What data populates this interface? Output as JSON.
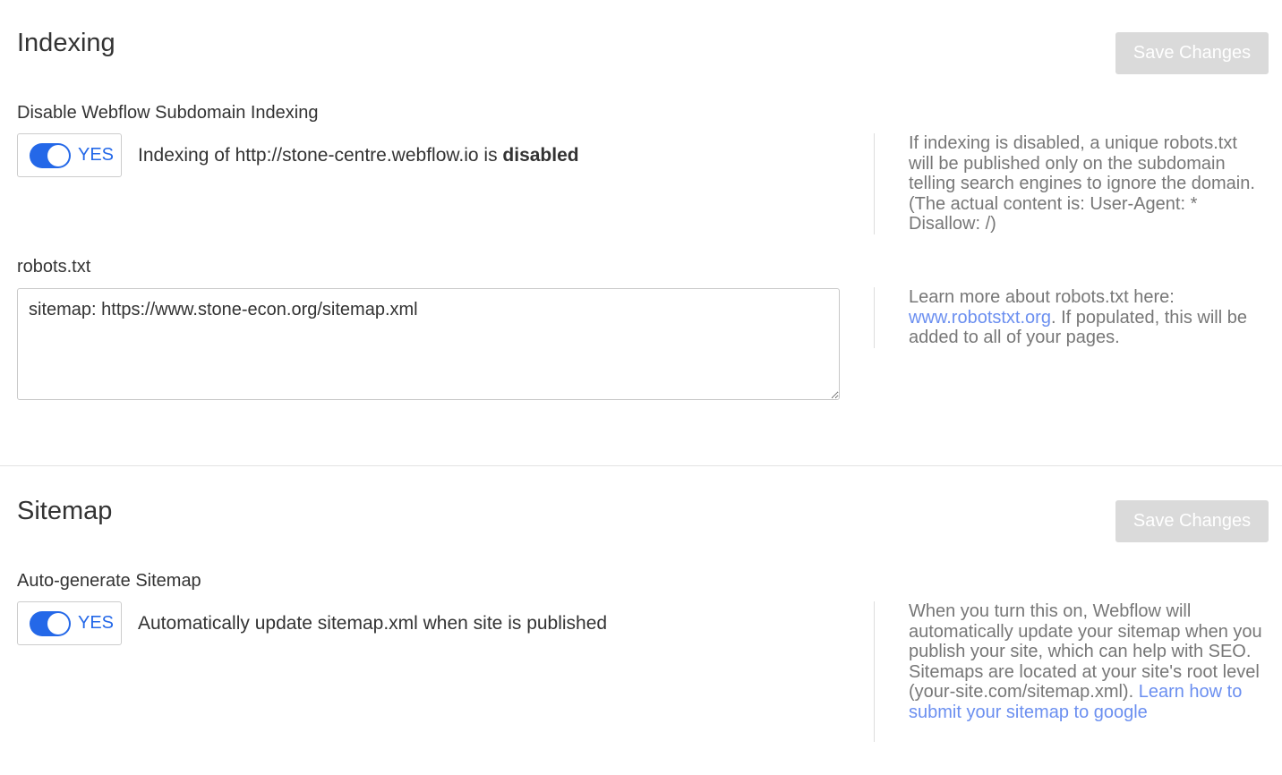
{
  "indexing": {
    "title": "Indexing",
    "save_label": "Save Changes",
    "subdomain_label": "Disable Webflow Subdomain Indexing",
    "toggle_label": "YES",
    "status_prefix": "Indexing of http://stone-centre.webflow.io is ",
    "status_bold": "disabled",
    "help_text": "If indexing is disabled, a unique robots.txt will be published only on the subdomain telling search engines to ignore the domain. (The actual content is: User-Agent: * Disallow: /)",
    "robots_label": "robots.txt",
    "robots_value": "sitemap: https://www.stone-econ.org/sitemap.xml",
    "robots_help_prefix": "Learn more about robots.txt here: ",
    "robots_help_link": "www.robotstxt.org",
    "robots_help_suffix": ". If populated, this will be added to all of your pages."
  },
  "sitemap": {
    "title": "Sitemap",
    "save_label": "Save Changes",
    "auto_label": "Auto-generate Sitemap",
    "toggle_label": "YES",
    "status_text": "Automatically update sitemap.xml when site is published",
    "help_text": "When you turn this on, Webflow will automatically update your sitemap when you publish your site, which can help with SEO. Sitemaps are located at your site's root level (your-site.com/sitemap.xml).",
    "help_link": "Learn how to submit your sitemap to google"
  },
  "colors": {
    "accent": "#2468e8",
    "link": "#6b8ff0",
    "button_disabled_bg": "#dadada",
    "help_text": "#777777"
  },
  "icons": {
    "toggle": "toggle-switch-on-icon",
    "resize": "textarea-resize-handle-icon"
  }
}
